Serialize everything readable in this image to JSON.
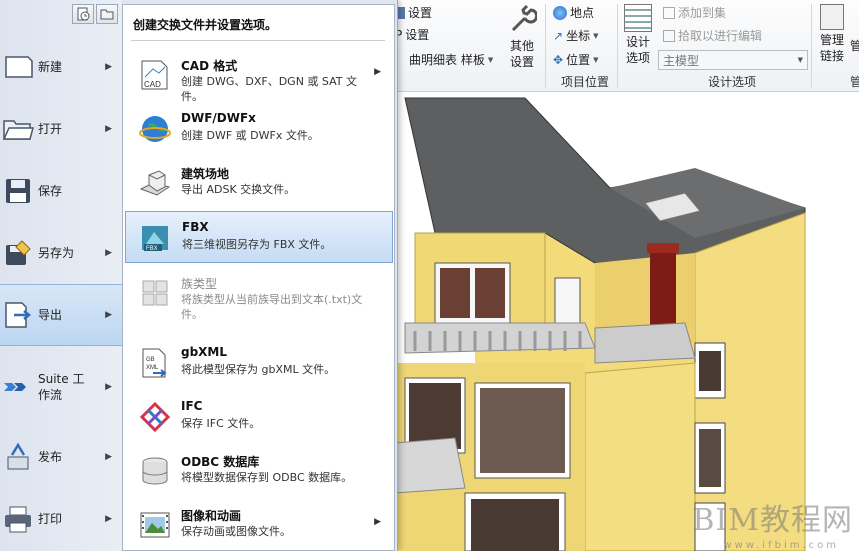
{
  "ribbon": {
    "settings_top": "设置",
    "settings_mid": "设置",
    "settings_prefix": "P",
    "curve_schedule": "曲明细表 样板",
    "other_settings_1": "其他",
    "other_settings_2": "设置",
    "location": "地点",
    "coordinates": "坐标",
    "position": "位置",
    "project_location_group": "项目位置",
    "design_options_1": "设计",
    "design_options_2": "选项",
    "add_to_set": "添加到集",
    "pick_to_edit": "拾取以进行编辑",
    "main_model": "主模型",
    "design_options_group": "设计选项",
    "manage_links_1": "管理",
    "manage_links_2": "链接",
    "manage_cut_1": "管",
    "manage_cut_2": "管"
  },
  "app_menu": {
    "rail": [
      {
        "label": "新建",
        "icon": "new-document-icon"
      },
      {
        "label": "打开",
        "icon": "open-folder-icon"
      },
      {
        "label": "保存",
        "icon": "floppy-disk-icon"
      },
      {
        "label": "另存为",
        "icon": "save-as-icon"
      },
      {
        "label": "导出",
        "icon": "export-icon"
      },
      {
        "label": "Suite 工作流",
        "icon": "suite-workflow-icon"
      },
      {
        "label": "发布",
        "icon": "publish-icon"
      },
      {
        "label": "打印",
        "icon": "printer-icon"
      }
    ],
    "submenu_title": "创建交换文件并设置选项。",
    "submenu": [
      {
        "title": "CAD 格式",
        "desc": "创建 DWG、DXF、DGN 或 SAT 文件。",
        "icon": "cad-format-icon"
      },
      {
        "title": "DWF/DWFx",
        "desc": "创建 DWF 或 DWFx 文件。",
        "icon": "dwf-globe-icon"
      },
      {
        "title": "建筑场地",
        "desc": "导出 ADSK 交换文件。",
        "icon": "building-site-icon"
      },
      {
        "title": "FBX",
        "desc": "将三维视图另存为 FBX 文件。",
        "icon": "fbx-icon"
      },
      {
        "title": "族类型",
        "desc": "将族类型从当前族导出到文本(.txt)文件。",
        "icon": "family-types-icon"
      },
      {
        "title": "gbXML",
        "desc": "将此模型保存为 gbXML 文件。",
        "icon": "gbxml-icon"
      },
      {
        "title": "IFC",
        "desc": "保存 IFC 文件。",
        "icon": "ifc-icon"
      },
      {
        "title": "ODBC 数据库",
        "desc": "将模型数据保存到 ODBC 数据库。",
        "icon": "database-icon"
      },
      {
        "title": "图像和动画",
        "desc": "保存动画或图像文件。",
        "icon": "image-animation-icon"
      }
    ]
  },
  "watermark": {
    "text": "BIM教程网",
    "url": "www.ifbim.com"
  }
}
